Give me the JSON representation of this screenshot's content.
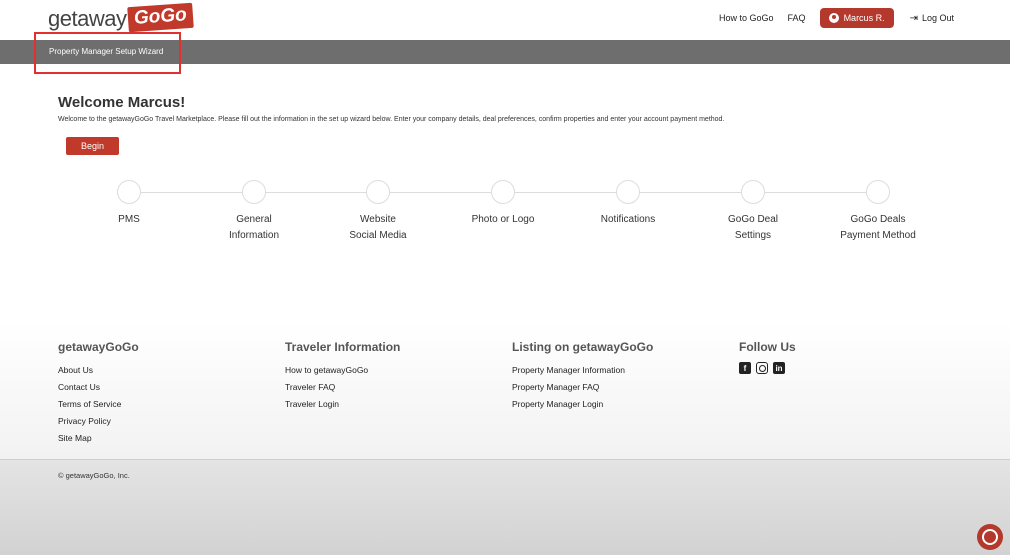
{
  "header": {
    "logo_text": "getaway",
    "logo_badge": "GoGo",
    "nav": {
      "how_to": "How to GoGo",
      "faq": "FAQ",
      "user": "Marcus R.",
      "logout": "Log Out"
    }
  },
  "wizard_bar": {
    "label": "Property Manager Setup Wizard"
  },
  "main": {
    "title": "Welcome Marcus!",
    "intro": "Welcome to the getawayGoGo Travel Marketplace. Please fill out the information in the set up wizard below. Enter your company details, deal preferences, confirm properties and enter your account payment method.",
    "begin_label": "Begin"
  },
  "steps": [
    {
      "label": "PMS"
    },
    {
      "label": "General\nInformation"
    },
    {
      "label": "Website\nSocial Media"
    },
    {
      "label": "Photo or Logo"
    },
    {
      "label": "Notifications"
    },
    {
      "label": "GoGo Deal\nSettings"
    },
    {
      "label": "GoGo Deals\nPayment Method"
    }
  ],
  "footer": {
    "col1": {
      "heading": "getawayGoGo",
      "links": [
        "About Us",
        "Contact Us",
        "Terms of Service",
        "Privacy Policy",
        "Site Map"
      ]
    },
    "col2": {
      "heading": "Traveler Information",
      "links": [
        "How to getawayGoGo",
        "Traveler FAQ",
        "Traveler Login"
      ]
    },
    "col3": {
      "heading": "Listing on getawayGoGo",
      "links": [
        "Property Manager Information",
        "Property Manager FAQ",
        "Property Manager Login"
      ]
    },
    "col4": {
      "heading": "Follow Us",
      "icons": [
        "facebook-icon",
        "instagram-icon",
        "linkedin-icon"
      ]
    },
    "copyright": "© getawayGoGo, Inc."
  },
  "colors": {
    "brand_red": "#c0392b",
    "wizard_bar": "#6e6e6e",
    "highlight": "#e03030"
  }
}
